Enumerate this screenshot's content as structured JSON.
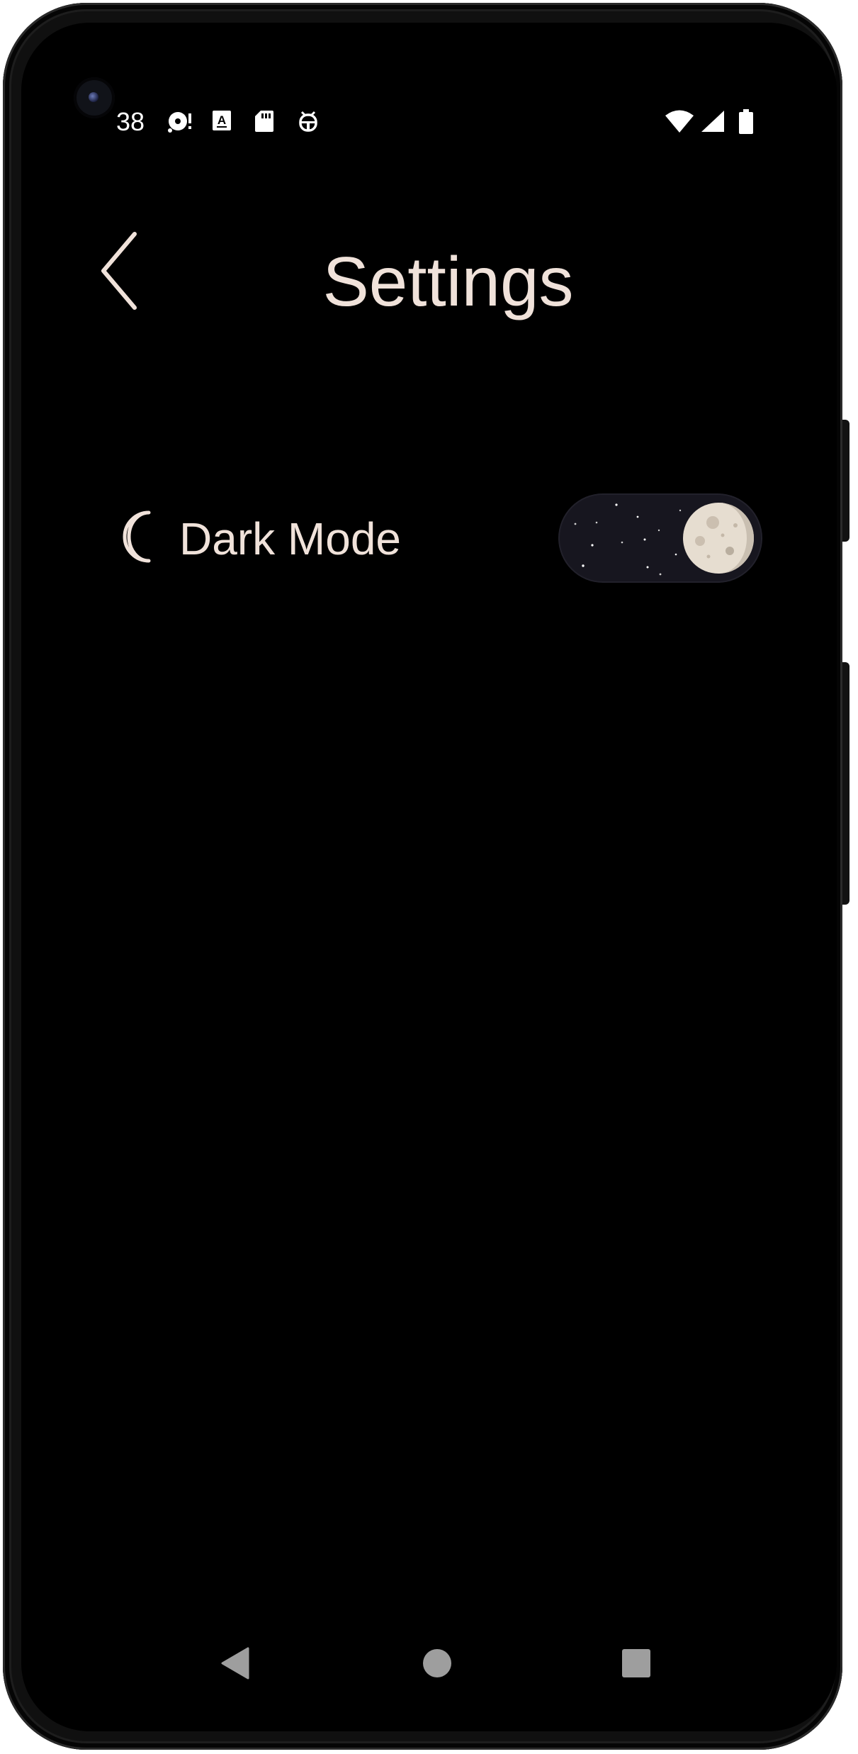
{
  "status_bar": {
    "time": "38",
    "left_icons": [
      "media-disc-icon",
      "text-a-icon",
      "sd-card-icon",
      "bug-icon"
    ],
    "right_icons": [
      "wifi-icon",
      "cell-signal-icon",
      "battery-icon"
    ]
  },
  "header": {
    "title": "Settings",
    "back_icon": "chevron-left-icon"
  },
  "settings": {
    "dark_mode": {
      "label": "Dark Mode",
      "icon": "crescent-moon-icon",
      "enabled": true
    }
  },
  "nav_bar": {
    "buttons": [
      "back-triangle-icon",
      "home-circle-icon",
      "recents-square-icon"
    ]
  },
  "colors": {
    "background": "#000000",
    "text": "#f0e2da",
    "toggle_track": "#17161f",
    "moon": "#e6ddd0"
  }
}
